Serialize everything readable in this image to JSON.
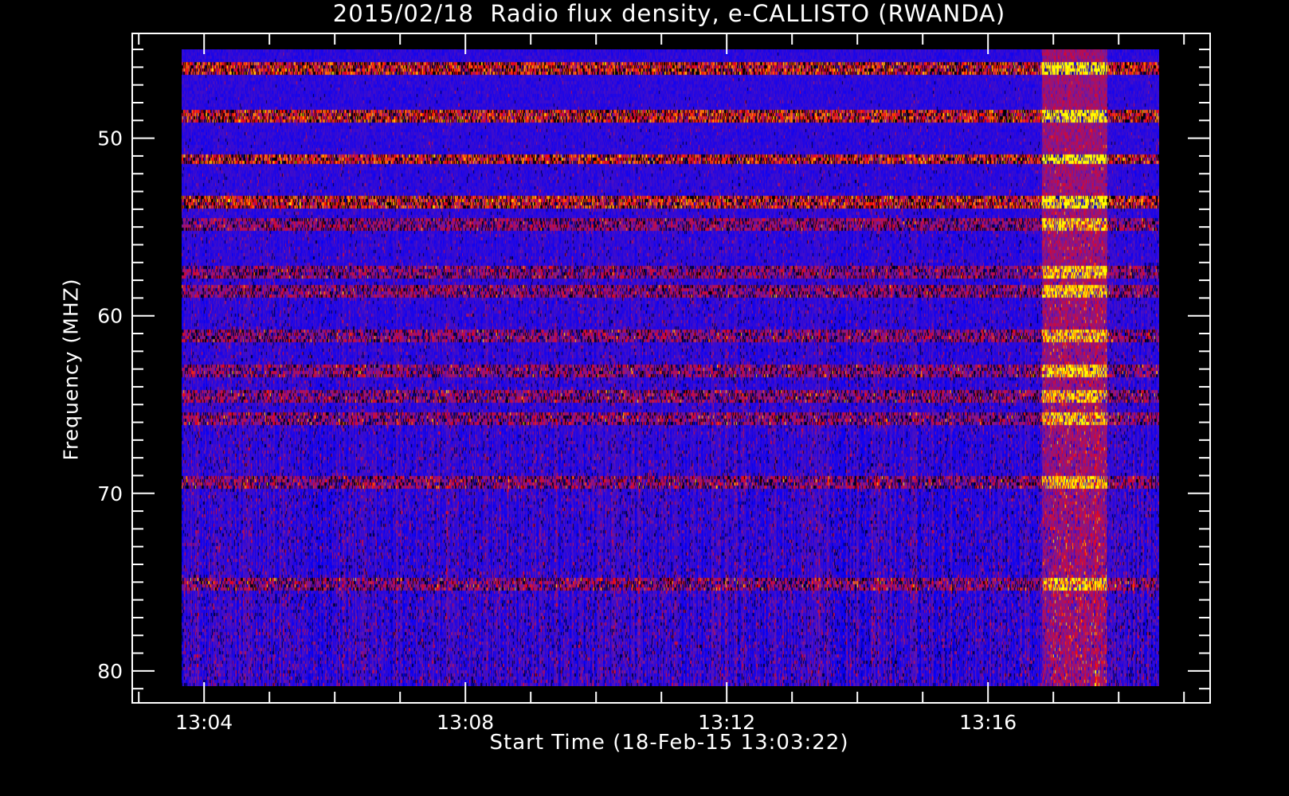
{
  "chart_data": {
    "type": "heatmap",
    "title": "2015/02/18  Radio flux density, e-CALLISTO (RWANDA)",
    "xlabel": "Start Time (18-Feb-15 13:03:22)",
    "ylabel": "Frequency (MHZ)",
    "x_axis": {
      "unit": "minutes after 13:00",
      "range": [
        2.9,
        19.4
      ],
      "data_range": [
        3.65,
        18.6
      ],
      "major_ticks": [
        4,
        8,
        12,
        16
      ],
      "tick_labels": [
        "13:04",
        "13:08",
        "13:12",
        "13:16"
      ],
      "minor_tick_step": 1
    },
    "y_axis": {
      "unit": "MHz",
      "inverted": true,
      "range": [
        44.1,
        81.8
      ],
      "data_range": [
        45.0,
        80.9
      ],
      "major_ticks": [
        50,
        60,
        70,
        80
      ],
      "tick_labels": [
        "50",
        "60",
        "70",
        "80"
      ],
      "minor_tick_step": 1
    },
    "colormap": [
      "#000000",
      "#0000ff",
      "#7a1a9a",
      "#ff0000",
      "#ffff00"
    ],
    "features": {
      "interference_bands_mhz": [
        46.0,
        48.6,
        51.1,
        53.5,
        54.8,
        57.5,
        58.5,
        61.0,
        63.1,
        64.4,
        65.7,
        69.3,
        75.0
      ],
      "burst_region": {
        "time_min": [
          16.8,
          17.8
        ],
        "freq_mhz": [
          45.5,
          81
        ]
      }
    },
    "grid": false
  }
}
